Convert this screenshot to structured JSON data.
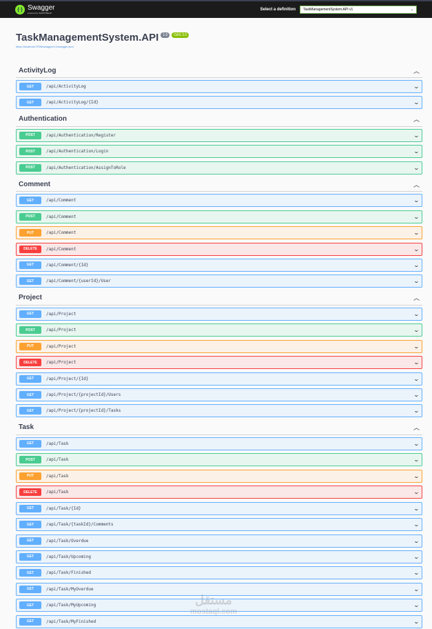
{
  "topbar": {
    "logo": "Swagger",
    "logo_sub": "powered by SMARTBEAR",
    "definition_label": "Select a definition",
    "definition_value": "TaskManagementSystem.API v1"
  },
  "info": {
    "title": "TaskManagementSystem.API",
    "version": "1.0",
    "oas": "OAS 3.0",
    "url": "https://localhost:7096/swagger/v1/swagger.json"
  },
  "sections": [
    {
      "name": "ActivityLog",
      "ops": [
        {
          "method": "GET",
          "path": "/api/ActivityLog"
        },
        {
          "method": "GET",
          "path": "/api/ActivityLog/{Id}"
        }
      ]
    },
    {
      "name": "Authentication",
      "ops": [
        {
          "method": "POST",
          "path": "/api/Authentication/Register"
        },
        {
          "method": "POST",
          "path": "/api/Authentication/Login"
        },
        {
          "method": "POST",
          "path": "/api/Authentication/AssignToRole"
        }
      ]
    },
    {
      "name": "Comment",
      "ops": [
        {
          "method": "GET",
          "path": "/api/Comment"
        },
        {
          "method": "POST",
          "path": "/api/Comment"
        },
        {
          "method": "PUT",
          "path": "/api/Comment"
        },
        {
          "method": "DELETE",
          "path": "/api/Comment"
        },
        {
          "method": "GET",
          "path": "/api/Comment/{Id}"
        },
        {
          "method": "GET",
          "path": "/api/Comment/{userId}/User"
        }
      ]
    },
    {
      "name": "Project",
      "ops": [
        {
          "method": "GET",
          "path": "/api/Project"
        },
        {
          "method": "POST",
          "path": "/api/Project"
        },
        {
          "method": "PUT",
          "path": "/api/Project"
        },
        {
          "method": "DELETE",
          "path": "/api/Project"
        },
        {
          "method": "GET",
          "path": "/api/Project/{Id}"
        },
        {
          "method": "GET",
          "path": "/api/Project/{projectId}/Users"
        },
        {
          "method": "GET",
          "path": "/api/Project/{projectId}/Tasks"
        }
      ]
    },
    {
      "name": "Task",
      "ops": [
        {
          "method": "GET",
          "path": "/api/Task"
        },
        {
          "method": "POST",
          "path": "/api/Task"
        },
        {
          "method": "PUT",
          "path": "/api/Task"
        },
        {
          "method": "DELETE",
          "path": "/api/Task"
        },
        {
          "method": "GET",
          "path": "/api/Task/{Id}"
        },
        {
          "method": "GET",
          "path": "/api/Task/{taskId}/Comments"
        },
        {
          "method": "GET",
          "path": "/api/Task/Overdue"
        },
        {
          "method": "GET",
          "path": "/api/Task/Upcoming"
        },
        {
          "method": "GET",
          "path": "/api/Task/Finished"
        },
        {
          "method": "GET",
          "path": "/api/Task/MyOverdue"
        },
        {
          "method": "GET",
          "path": "/api/Task/MyUpcoming"
        },
        {
          "method": "GET",
          "path": "/api/Task/MyFinished"
        }
      ]
    }
  ],
  "watermark": "mostaql.com"
}
